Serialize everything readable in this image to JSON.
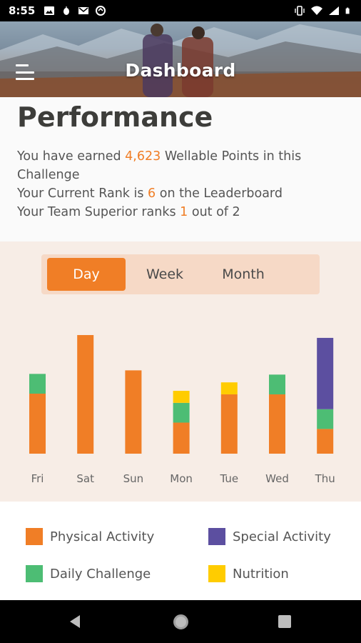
{
  "status_bar": {
    "time": "8:55",
    "left_icons": [
      "image-icon",
      "bug-icon",
      "mail-icon",
      "sync-icon"
    ],
    "right_icons": [
      "vibrate-icon",
      "wifi-icon",
      "signal-icon",
      "battery-icon"
    ]
  },
  "header": {
    "title": "Dashboard",
    "menu_icon": "hamburger-menu-icon"
  },
  "performance": {
    "title": "Performance",
    "line1_prefix": "You have earned ",
    "points": "4,623",
    "line1_suffix": " Wellable Points in this Challenge",
    "line2_prefix": "Your Current Rank is ",
    "rank": "6",
    "line2_suffix": " on the Leaderboard",
    "line3_prefix": "Your Team Superior ranks ",
    "team_rank": "1",
    "line3_suffix": " out of 2"
  },
  "tabs": {
    "items": [
      "Day",
      "Week",
      "Month"
    ],
    "selected": "Day"
  },
  "colors": {
    "physical": "#f07e26",
    "daily": "#4dbd74",
    "special": "#5c4fa0",
    "nutrition": "#ffcc00",
    "accent": "#f07e26"
  },
  "chart_data": {
    "type": "bar",
    "stacked": true,
    "categories": [
      "Fri",
      "Sat",
      "Sun",
      "Mon",
      "Tue",
      "Wed",
      "Thu"
    ],
    "series": [
      {
        "name": "Physical Activity",
        "color": "#f07e26",
        "values": [
          85,
          168,
          118,
          44,
          84,
          84,
          35
        ]
      },
      {
        "name": "Daily Challenge",
        "color": "#4dbd74",
        "values": [
          28,
          0,
          0,
          28,
          0,
          28,
          28
        ]
      },
      {
        "name": "Nutrition",
        "color": "#ffcc00",
        "values": [
          0,
          0,
          0,
          17,
          17,
          0,
          0
        ]
      },
      {
        "name": "Special Activity",
        "color": "#5c4fa0",
        "values": [
          0,
          0,
          0,
          0,
          0,
          0,
          101
        ]
      }
    ],
    "ylim": [
      0,
      170
    ],
    "grid": false,
    "legend": "bottom"
  },
  "legend": {
    "items": [
      {
        "label": "Physical Activity",
        "color": "#f07e26"
      },
      {
        "label": "Special Activity",
        "color": "#5c4fa0"
      },
      {
        "label": "Daily Challenge",
        "color": "#4dbd74"
      },
      {
        "label": "Nutrition",
        "color": "#ffcc00"
      }
    ]
  },
  "nav_bar": {
    "icons": [
      "back-icon",
      "home-icon",
      "recent-apps-icon"
    ]
  }
}
